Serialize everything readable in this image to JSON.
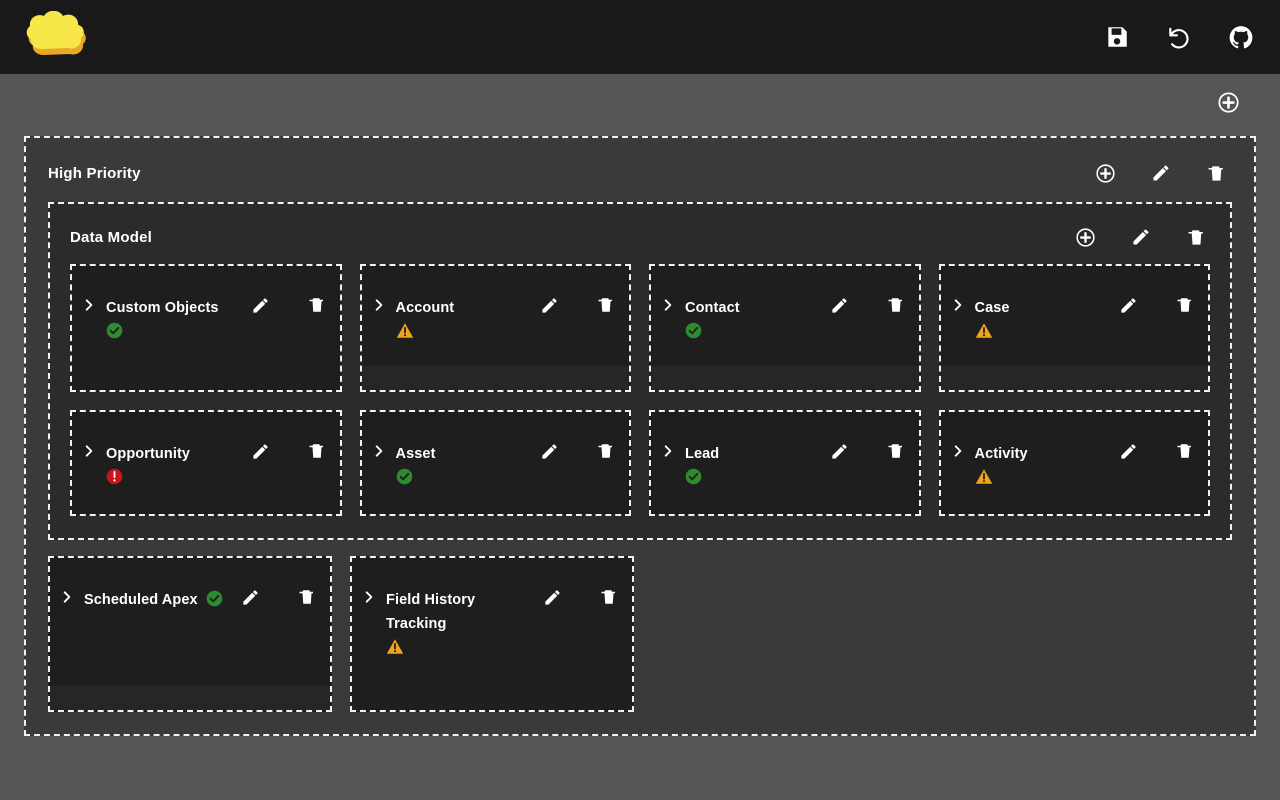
{
  "app": {
    "logo_icon": "cloud-logo-icon",
    "logo_color": "#f5e14b",
    "titlebar_bg": "#191919"
  },
  "topbar": {
    "actions": [
      {
        "name": "save-button",
        "icon": "floppy-disk-icon",
        "label": "Save"
      },
      {
        "name": "undo-button",
        "icon": "undo-arrow-icon",
        "label": "Undo"
      },
      {
        "name": "github-button",
        "icon": "github-icon",
        "label": "GitHub"
      }
    ]
  },
  "page_toolbar": {
    "add_group": {
      "name": "add-group-button",
      "icon": "circle-plus-icon",
      "label": "Add"
    }
  },
  "colors": {
    "page_bg": "#555555",
    "group_outer_bg": "#3a3a3a",
    "group_inner_bg": "#2b2b2b",
    "card_bg": "#1e1e1e",
    "card_footer_bg": "#262626",
    "dash_border": "#f2f2f2",
    "status_success": "#2e8b2e",
    "status_warning": "#f0a41a",
    "status_error": "#c4161c",
    "text": "#ffffff"
  },
  "group": {
    "title": "High Priority",
    "actions": [
      {
        "name": "add-item-button",
        "icon": "circle-plus-icon",
        "label": "Add"
      },
      {
        "name": "edit-group-button",
        "icon": "pencil-icon",
        "label": "Edit"
      },
      {
        "name": "delete-group-button",
        "icon": "trash-icon",
        "label": "Delete"
      }
    ],
    "subgroup": {
      "title": "Data Model",
      "actions": [
        {
          "name": "add-item-button",
          "icon": "circle-plus-icon",
          "label": "Add"
        },
        {
          "name": "edit-subgroup-button",
          "icon": "pencil-icon",
          "label": "Edit"
        },
        {
          "name": "delete-subgroup-button",
          "icon": "trash-icon",
          "label": "Delete"
        }
      ],
      "cards": [
        {
          "title": "Custom Objects",
          "status": "success",
          "status_inline": false,
          "footer": false,
          "height": "normal"
        },
        {
          "title": "Account",
          "status": "warning",
          "status_inline": false,
          "footer": true,
          "height": "normal"
        },
        {
          "title": "Contact",
          "status": "success",
          "status_inline": false,
          "footer": true,
          "height": "normal"
        },
        {
          "title": "Case",
          "status": "warning",
          "status_inline": false,
          "footer": true,
          "height": "normal"
        },
        {
          "title": "Opportunity",
          "status": "error",
          "status_inline": false,
          "footer": false,
          "height": "short"
        },
        {
          "title": "Asset",
          "status": "success",
          "status_inline": false,
          "footer": false,
          "height": "short"
        },
        {
          "title": "Lead",
          "status": "success",
          "status_inline": false,
          "footer": false,
          "height": "short"
        },
        {
          "title": "Activity",
          "status": "warning",
          "status_inline": false,
          "footer": false,
          "height": "short"
        }
      ]
    },
    "loose_cards": [
      {
        "title": "Scheduled Apex",
        "status": "success",
        "status_inline": true,
        "footer": true,
        "height": "tall"
      },
      {
        "title": "Field History Tracking",
        "status": "warning",
        "status_inline": false,
        "footer": false,
        "height": "tall"
      }
    ]
  },
  "card_actions": [
    {
      "name": "expand-card-toggle",
      "icon": "chevron-right-icon"
    },
    {
      "name": "edit-card-button",
      "icon": "pencil-icon"
    },
    {
      "name": "delete-card-button",
      "icon": "trash-icon"
    }
  ]
}
